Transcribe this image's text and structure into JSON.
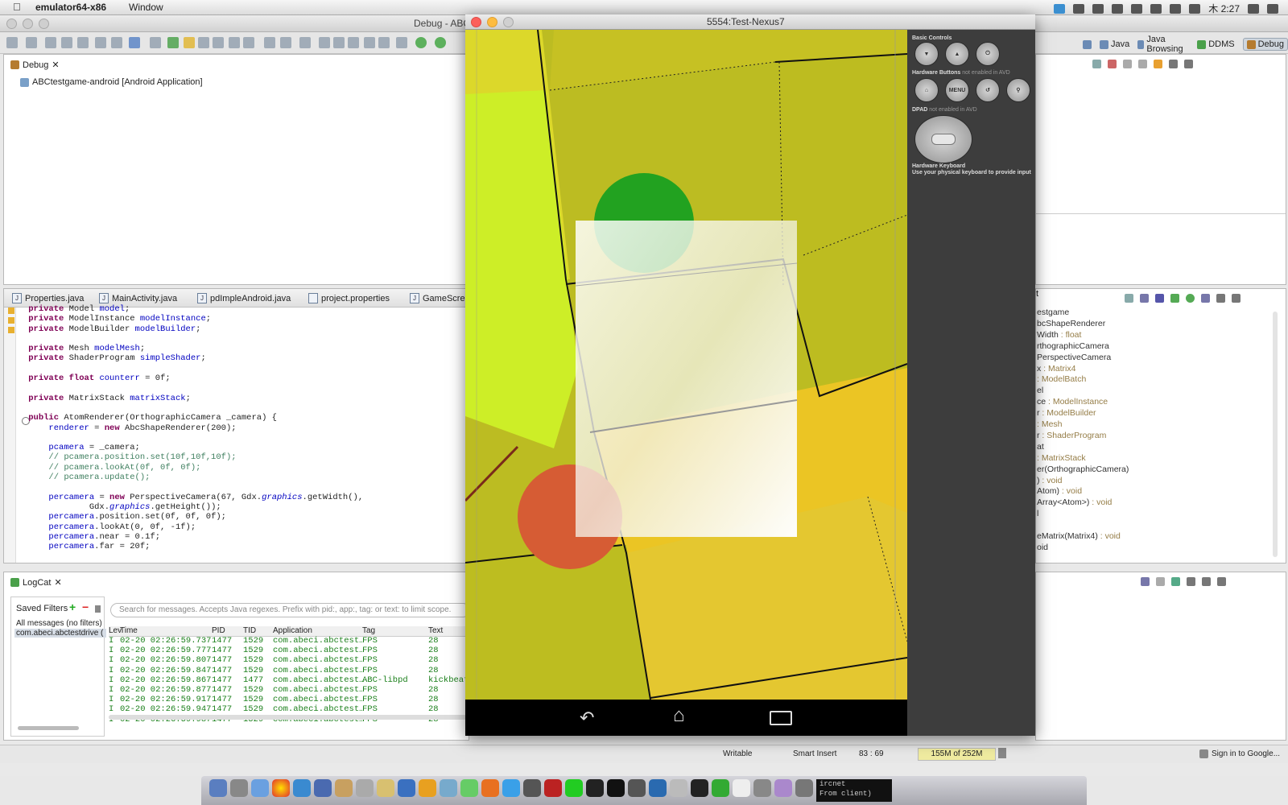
{
  "menubar": {
    "apple": "",
    "app_name": "emulator64-x86",
    "menu_window": "Window",
    "clock": "木 2:27"
  },
  "eclipse": {
    "title": "Debug - ABCte",
    "perspectives": [
      "Java",
      "Java Browsing",
      "DDMS",
      "Debug"
    ]
  },
  "debug_view": {
    "tab": "Debug",
    "launch_item": "ABCtestgame-android [Android Application]"
  },
  "editor": {
    "tabs": [
      "Properties.java",
      "MainActivity.java",
      "pdImpleAndroid.java",
      "project.properties",
      "GameScreen"
    ]
  },
  "logcat": {
    "tab": "LogCat",
    "saved_filters": "Saved Filters",
    "filter_all": "All messages (no filters)",
    "filter_selected": "com.abeci.abctestdrive (",
    "search_placeholder": "Search for messages. Accepts Java regexes. Prefix with pid:, app:, tag: or text: to limit scope.",
    "columns": [
      "Lev",
      "Time",
      "PID",
      "TID",
      "Application",
      "Tag",
      "Text"
    ],
    "rows": [
      {
        "lv": "I",
        "time": "02-20 02:26:59.737",
        "pid": "1477",
        "tid": "1529",
        "app": "com.abeci.abctest…",
        "tag": "FPS",
        "text": "28"
      },
      {
        "lv": "I",
        "time": "02-20 02:26:59.777",
        "pid": "1477",
        "tid": "1529",
        "app": "com.abeci.abctest…",
        "tag": "FPS",
        "text": "28"
      },
      {
        "lv": "I",
        "time": "02-20 02:26:59.807",
        "pid": "1477",
        "tid": "1529",
        "app": "com.abeci.abctest…",
        "tag": "FPS",
        "text": "28"
      },
      {
        "lv": "I",
        "time": "02-20 02:26:59.847",
        "pid": "1477",
        "tid": "1529",
        "app": "com.abeci.abctest…",
        "tag": "FPS",
        "text": "28"
      },
      {
        "lv": "I",
        "time": "02-20 02:26:59.867",
        "pid": "1477",
        "tid": "1477",
        "app": "com.abeci.abctest…",
        "tag": "ABC-libpd",
        "text": "kickbeat"
      },
      {
        "lv": "I",
        "time": "02-20 02:26:59.877",
        "pid": "1477",
        "tid": "1529",
        "app": "com.abeci.abctest…",
        "tag": "FPS",
        "text": "28"
      },
      {
        "lv": "I",
        "time": "02-20 02:26:59.917",
        "pid": "1477",
        "tid": "1529",
        "app": "com.abeci.abctest…",
        "tag": "FPS",
        "text": "28"
      },
      {
        "lv": "I",
        "time": "02-20 02:26:59.947",
        "pid": "1477",
        "tid": "1529",
        "app": "com.abeci.abctest…",
        "tag": "FPS",
        "text": "28"
      },
      {
        "lv": "I",
        "time": "02-20 02:26:59.987",
        "pid": "1477",
        "tid": "1529",
        "app": "com.abeci.abctest…",
        "tag": "FPS",
        "text": "28"
      }
    ]
  },
  "emulator": {
    "title": "5554:Test-Nexus7",
    "basic_controls": "Basic Controls",
    "hw_buttons": "Hardware Buttons",
    "hw_buttons_note": "not enabled in AVD",
    "menu_btn": "MENU",
    "dpad": "DPAD",
    "dpad_note": "not enabled in AVD",
    "hw_keyboard": "Hardware Keyboard",
    "hw_keyboard_note": "Use your physical keyboard to provide input"
  },
  "outline": {
    "items": [
      {
        "name": "estgame",
        "type": ""
      },
      {
        "name": "bcShapeRenderer",
        "type": ""
      },
      {
        "name": "Width",
        "type": " : float"
      },
      {
        "name": "rthographicCamera",
        "type": ""
      },
      {
        "name": "PerspectiveCamera",
        "type": ""
      },
      {
        "name": "x",
        "type": " : Matrix4"
      },
      {
        "name": "",
        "type": " : ModelBatch"
      },
      {
        "name": "el",
        "type": ""
      },
      {
        "name": "ce",
        "type": " : ModelInstance"
      },
      {
        "name": "r",
        "type": " : ModelBuilder"
      },
      {
        "name": "",
        "type": " : Mesh"
      },
      {
        "name": "r",
        "type": " : ShaderProgram"
      },
      {
        "name": "at",
        "type": ""
      },
      {
        "name": "",
        "type": " : MatrixStack"
      },
      {
        "name": "er(OrthographicCamera)",
        "type": ""
      },
      {
        "name": ")",
        "type": " : void"
      },
      {
        "name": "Atom)",
        "type": " : void"
      },
      {
        "name": "Array<Atom>)",
        "type": " : void"
      },
      {
        "name": "l",
        "type": ""
      },
      {
        "name": "",
        "type": ""
      },
      {
        "name": "eMatrix(Matrix4)",
        "type": " : void"
      },
      {
        "name": "oid",
        "type": ""
      }
    ]
  },
  "status": {
    "writable": "Writable",
    "insert": "Smart Insert",
    "position": "83 : 69",
    "heap": "155M of 252M",
    "sign_in": "Sign in to Google..."
  },
  "dock": {
    "terminal_text_1": "ircnet",
    "terminal_text_2": "From client)"
  }
}
